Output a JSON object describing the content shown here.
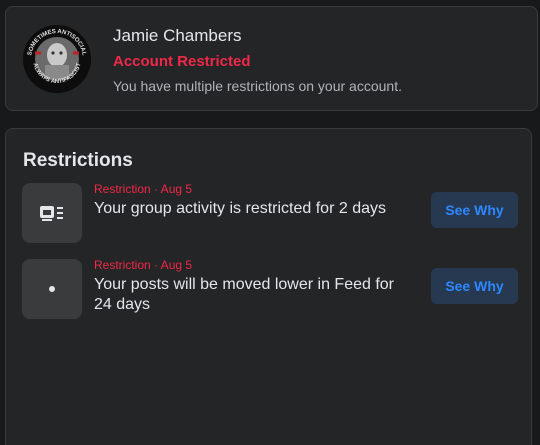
{
  "account": {
    "name": "Jamie Chambers",
    "status": "Account Restricted",
    "description": "You have multiple restrictions on your account.",
    "avatar_ring_text_top": "SOMETIMES ANTISOCIAL",
    "avatar_ring_text_bottom": "ALWAYS ANTIFASCIST"
  },
  "restrictions": {
    "section_title": "Restrictions",
    "items": [
      {
        "meta": "Restriction · Aug 5",
        "title": "Your group activity is restricted for 2 days",
        "icon": "group-activity-icon",
        "button": "See Why"
      },
      {
        "meta": "Restriction · Aug 5",
        "title": "Your posts will be moved lower in Feed for 24 days",
        "icon": "feed-dot-icon",
        "button": "See Why"
      }
    ]
  },
  "colors": {
    "background": "#18191a",
    "card": "#242526",
    "accent_red": "#f02849",
    "button_bg": "#263951",
    "button_text": "#2d88ff"
  }
}
